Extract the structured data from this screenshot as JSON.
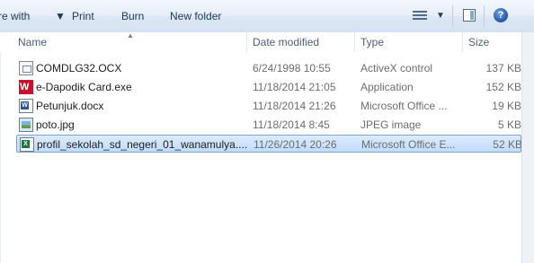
{
  "toolbar": {
    "share_label": "re with",
    "print_label": "Print",
    "burn_label": "Burn",
    "new_folder_label": "New folder",
    "help_label": "?"
  },
  "columns": {
    "name": "Name",
    "date": "Date modified",
    "type": "Type",
    "size": "Size"
  },
  "files": [
    {
      "name": "COMDLG32.OCX",
      "date": "6/24/1998 10:55",
      "type": "ActiveX control",
      "size": "137 KB",
      "icon": "ocx-file-icon"
    },
    {
      "name": "e-Dapodik Card.exe",
      "date": "11/18/2014 21:05",
      "type": "Application",
      "size": "152 KB",
      "icon": "exe-file-icon"
    },
    {
      "name": "Petunjuk.docx",
      "date": "11/18/2014 21:26",
      "type": "Microsoft Office ...",
      "size": "19 KB",
      "icon": "word-file-icon"
    },
    {
      "name": "poto.jpg",
      "date": "11/18/2014 8:45",
      "type": "JPEG image",
      "size": "5 KB",
      "icon": "jpeg-file-icon"
    },
    {
      "name": "profil_sekolah_sd_negeri_01_wanamulya....",
      "date": "11/26/2014 20:26",
      "type": "Microsoft Office E...",
      "size": "52 KB",
      "icon": "excel-file-icon",
      "selected": true
    }
  ],
  "colors": {
    "selection": "#c1dcfc",
    "selection_border": "#7da2ce",
    "toolbar_text": "#1e395b"
  }
}
